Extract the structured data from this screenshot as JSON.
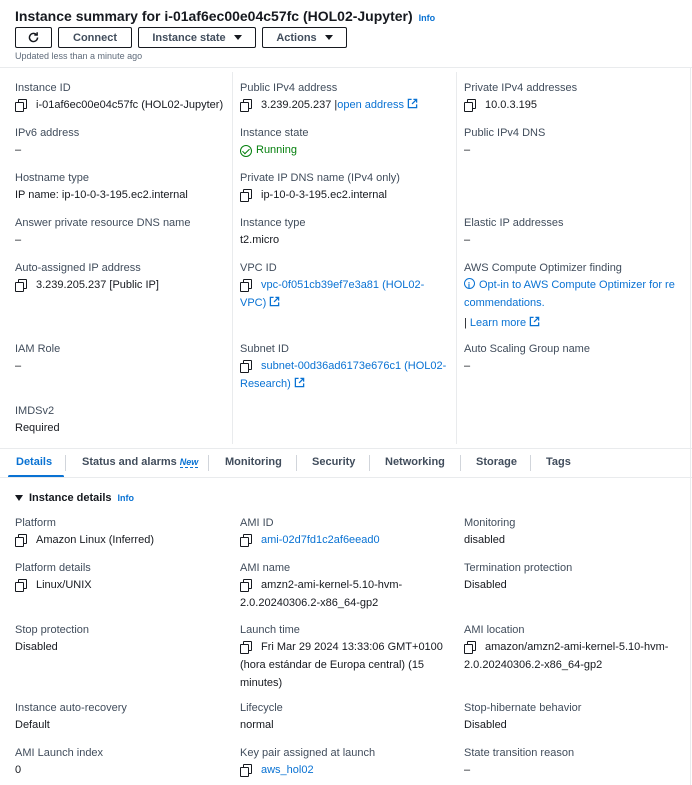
{
  "header": {
    "title": "Instance summary for i-01af6ec00e04c57fc (HOL02-Jupyter)",
    "info": "Info",
    "buttons": {
      "connect": "Connect",
      "instance_state": "Instance state",
      "actions": "Actions"
    },
    "updated": "Updated less than a minute ago"
  },
  "summary": {
    "instance_id": {
      "label": "Instance ID",
      "value": "i-01af6ec00e04c57fc (HOL02-Jupyter)"
    },
    "public_ipv4": {
      "label": "Public IPv4 address",
      "value": "3.239.205.237",
      "link": "open address"
    },
    "private_ipv4": {
      "label": "Private IPv4 addresses",
      "value": "10.0.3.195"
    },
    "ipv6": {
      "label": "IPv6 address",
      "value": "–"
    },
    "instance_state": {
      "label": "Instance state",
      "value": "Running"
    },
    "public_dns": {
      "label": "Public IPv4 DNS",
      "value": "–"
    },
    "hostname_type": {
      "label": "Hostname type",
      "value": "IP name: ip-10-0-3-195.ec2.internal"
    },
    "private_dns": {
      "label": "Private IP DNS name (IPv4 only)",
      "value": "ip-10-0-3-195.ec2.internal"
    },
    "answer_dns": {
      "label": "Answer private resource DNS name",
      "value": "–"
    },
    "instance_type": {
      "label": "Instance type",
      "value": "t2.micro"
    },
    "elastic_ip": {
      "label": "Elastic IP addresses",
      "value": "–"
    },
    "auto_ip": {
      "label": "Auto-assigned IP address",
      "value": "3.239.205.237 [Public IP]"
    },
    "vpc": {
      "label": "VPC ID",
      "value_line1": "vpc-0f051cb39ef7e3a81 (HOL02-",
      "value_line2": "VPC)"
    },
    "optimizer": {
      "label": "AWS Compute Optimizer finding",
      "line1": "Opt-in to AWS Compute Optimizer for re",
      "line2": "commendations.",
      "learn": "Learn more"
    },
    "iam": {
      "label": "IAM Role",
      "value": "–"
    },
    "subnet": {
      "label": "Subnet ID",
      "value_line1": "subnet-00d36ad6173e676c1 (HOL02-",
      "value_line2": "Research)"
    },
    "asg": {
      "label": "Auto Scaling Group name",
      "value": "–"
    },
    "imdsv2": {
      "label": "IMDSv2",
      "value": "Required"
    }
  },
  "tabs": [
    {
      "label": "Details"
    },
    {
      "label": "Status and alarms",
      "badge": "New"
    },
    {
      "label": "Monitoring"
    },
    {
      "label": "Security"
    },
    {
      "label": "Networking"
    },
    {
      "label": "Storage"
    },
    {
      "label": "Tags"
    }
  ],
  "details": {
    "title": "Instance details",
    "info": "Info",
    "platform": {
      "label": "Platform",
      "value": "Amazon Linux (Inferred)"
    },
    "ami_id": {
      "label": "AMI ID",
      "value": "ami-02d7fd1c2af6eead0"
    },
    "monitoring": {
      "label": "Monitoring",
      "value": "disabled"
    },
    "platform_details": {
      "label": "Platform details",
      "value": "Linux/UNIX"
    },
    "ami_name": {
      "label": "AMI name",
      "line1": "amzn2-ami-kernel-5.10-hvm-",
      "line2": "2.0.20240306.2-x86_64-gp2"
    },
    "termination": {
      "label": "Termination protection",
      "value": "Disabled"
    },
    "stop_protection": {
      "label": "Stop protection",
      "value": "Disabled"
    },
    "launch_time": {
      "label": "Launch time",
      "line1": "Fri Mar 29 2024 13:33:06 GMT+0100",
      "line2": "(hora estándar de Europa central) (15",
      "line3": "minutes)"
    },
    "ami_location": {
      "label": "AMI location",
      "line1": "amazon/amzn2-ami-kernel-5.10-hvm-",
      "line2": "2.0.20240306.2-x86_64-gp2"
    },
    "auto_recovery": {
      "label": "Instance auto-recovery",
      "value": "Default"
    },
    "lifecycle": {
      "label": "Lifecycle",
      "value": "normal"
    },
    "hibernate": {
      "label": "Stop-hibernate behavior",
      "value": "Disabled"
    },
    "ami_launch_index": {
      "label": "AMI Launch index",
      "value": "0"
    },
    "key_pair": {
      "label": "Key pair assigned at launch",
      "value": "aws_hol02"
    },
    "state_reason": {
      "label": "State transition reason",
      "value": "–"
    }
  }
}
